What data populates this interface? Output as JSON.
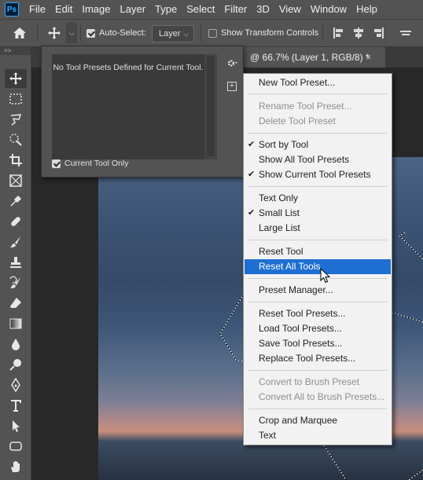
{
  "menubar": {
    "logo": "Ps",
    "items": [
      "File",
      "Edit",
      "Image",
      "Layer",
      "Type",
      "Select",
      "Filter",
      "3D",
      "View",
      "Window",
      "Help"
    ]
  },
  "options": {
    "auto_select_label": "Auto-Select:",
    "layer_value": "Layer",
    "show_transform_label": "Show Transform Controls"
  },
  "toolbar": {
    "collapse": ">>",
    "tools": [
      "move-tool-icon",
      "marquee-tool-icon",
      "lasso-tool-icon",
      "quick-selection-tool-icon",
      "crop-tool-icon",
      "frame-tool-icon",
      "eyedropper-tool-icon",
      "healing-brush-icon",
      "brush-tool-icon",
      "clone-stamp-icon",
      "history-brush-icon",
      "eraser-icon",
      "gradient-tool-icon",
      "blur-tool-icon",
      "dodge-tool-icon",
      "pen-tool-icon",
      "type-tool-icon",
      "path-selection-icon",
      "rectangle-tool-icon",
      "hand-tool-icon"
    ]
  },
  "document": {
    "tab_title": "@ 66.7% (Layer 1, RGB/8) *",
    "close": "×"
  },
  "presets_panel": {
    "empty_message": "No Tool Presets Defined for Current Tool.",
    "current_only_label": "Current Tool Only",
    "new_preset_symbol": "+"
  },
  "flyout": {
    "items": [
      {
        "label": "New Tool Preset...",
        "enabled": true,
        "checked": false
      },
      {
        "label": "Rename Tool Preset...",
        "enabled": false,
        "checked": false
      },
      {
        "label": "Delete Tool Preset",
        "enabled": false,
        "checked": false
      },
      {
        "label": "Sort by Tool",
        "enabled": true,
        "checked": true
      },
      {
        "label": "Show All Tool Presets",
        "enabled": true,
        "checked": false
      },
      {
        "label": "Show Current Tool Presets",
        "enabled": true,
        "checked": true
      },
      {
        "label": "Text Only",
        "enabled": true,
        "checked": false
      },
      {
        "label": "Small List",
        "enabled": true,
        "checked": true
      },
      {
        "label": "Large List",
        "enabled": true,
        "checked": false
      },
      {
        "label": "Reset Tool",
        "enabled": true,
        "checked": false
      },
      {
        "label": "Reset All Tools",
        "enabled": true,
        "checked": false,
        "highlighted": true
      },
      {
        "label": "Preset Manager...",
        "enabled": true,
        "checked": false
      },
      {
        "label": "Reset Tool Presets...",
        "enabled": true,
        "checked": false
      },
      {
        "label": "Load Tool Presets...",
        "enabled": true,
        "checked": false
      },
      {
        "label": "Save Tool Presets...",
        "enabled": true,
        "checked": false
      },
      {
        "label": "Replace Tool Presets...",
        "enabled": true,
        "checked": false
      },
      {
        "label": "Convert to Brush Preset",
        "enabled": false,
        "checked": false
      },
      {
        "label": "Convert All to Brush Presets...",
        "enabled": false,
        "checked": false
      },
      {
        "label": "Crop and Marquee",
        "enabled": true,
        "checked": false
      },
      {
        "label": "Text",
        "enabled": true,
        "checked": false
      }
    ],
    "check_glyph": "✔",
    "highlight_color": "#1e6fd1"
  }
}
